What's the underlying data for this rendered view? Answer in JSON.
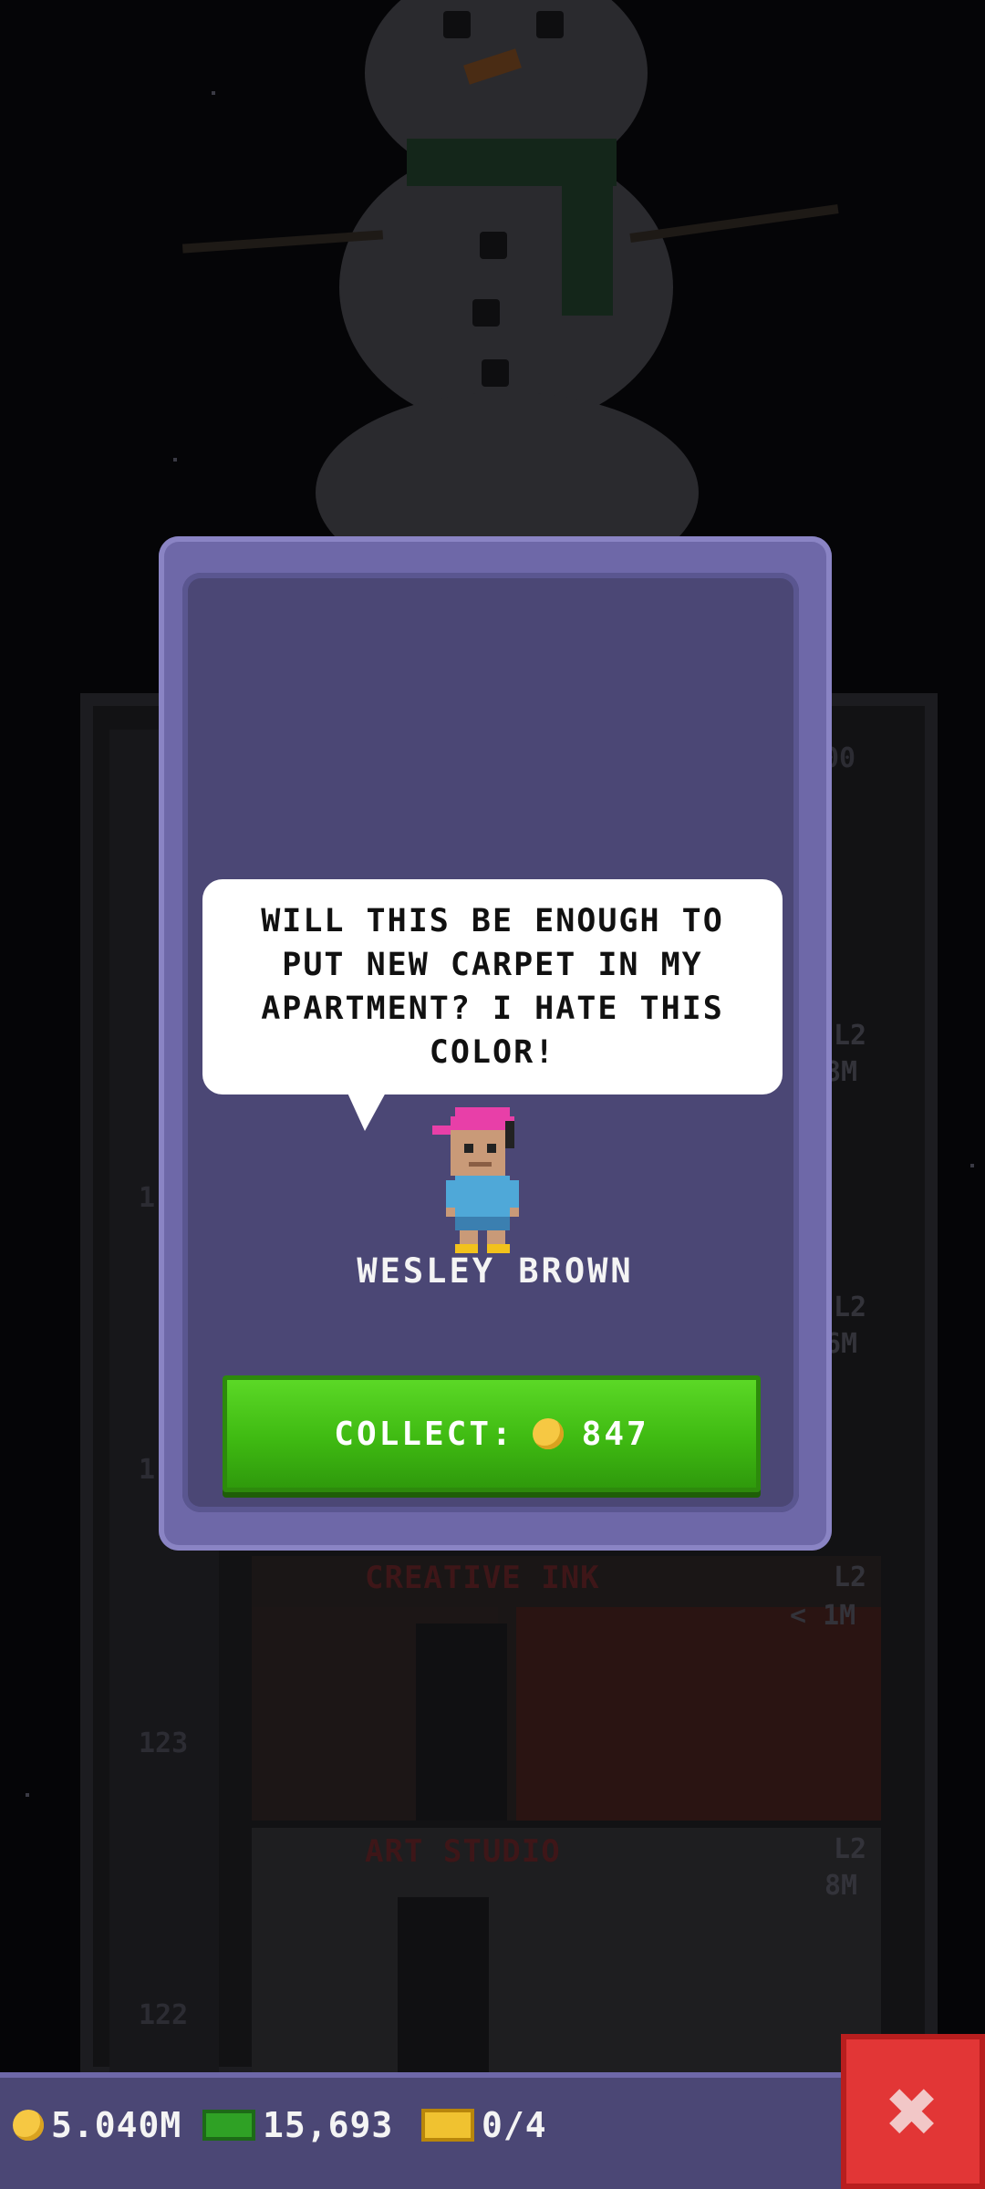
{
  "dialog": {
    "message": "WILL THIS BE ENOUGH TO PUT NEW CARPET IN MY APARTMENT? I HATE THIS COLOR!",
    "character_name": "WESLEY BROWN",
    "collect_label": "COLLECT:",
    "collect_amount": "847",
    "coin_icon": "coin-icon"
  },
  "background": {
    "floors": [
      {
        "name": "CREATIVE INK",
        "level": "L2",
        "price": "< 1M",
        "number": "123"
      },
      {
        "name": "ART STUDIO",
        "level": "L2",
        "price": "8M",
        "number": "122"
      }
    ],
    "upper_labels": [
      "00",
      "L2",
      "8M",
      "L2",
      "6M"
    ],
    "side_numbers": [
      "1",
      "1"
    ]
  },
  "status_bar": {
    "coins": "5.040M",
    "bux": "15,693",
    "tickets": "0/4"
  },
  "close_icon": "close-icon",
  "colors": {
    "dialog_frame": "#6e68a8",
    "dialog_panel": "#4b4775",
    "collect_green": "#3fba12",
    "close_red": "#e23636",
    "coin_gold": "#f6c843"
  }
}
